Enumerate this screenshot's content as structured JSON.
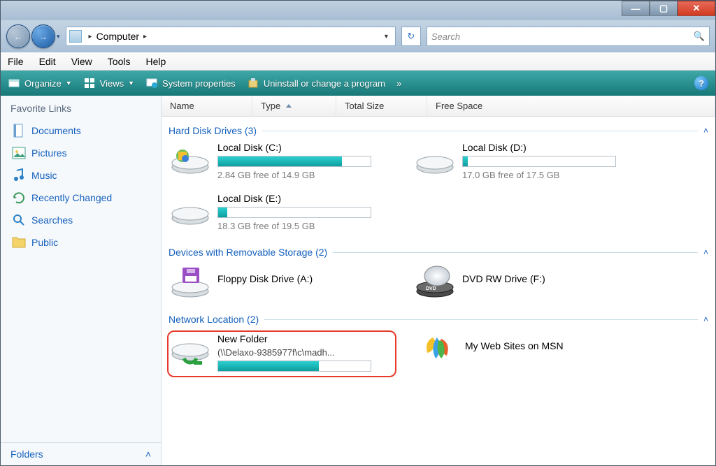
{
  "titlebar": {
    "min": "—",
    "max": "▢",
    "close": "✕"
  },
  "nav": {
    "back_arrow": "←",
    "fwd_arrow": "→",
    "breadcrumb_root": "Computer",
    "search_placeholder": "Search",
    "refresh_glyph": "↻",
    "dropdown_glyph": "▾",
    "mag_glyph": "🔍"
  },
  "menu": {
    "file": "File",
    "edit": "Edit",
    "view": "View",
    "tools": "Tools",
    "help": "Help"
  },
  "toolbar": {
    "organize": "Organize",
    "views": "Views",
    "sysprops": "System properties",
    "uninstall": "Uninstall or change a program",
    "overflow": "»",
    "caret": "▼"
  },
  "sidebar": {
    "header": "Favorite Links",
    "items": [
      {
        "label": "Documents",
        "icon": "doc"
      },
      {
        "label": "Pictures",
        "icon": "pic"
      },
      {
        "label": "Music",
        "icon": "music"
      },
      {
        "label": "Recently Changed",
        "icon": "recent"
      },
      {
        "label": "Searches",
        "icon": "search"
      },
      {
        "label": "Public",
        "icon": "public"
      }
    ],
    "folders_label": "Folders",
    "folders_caret": "˄"
  },
  "columns": {
    "name": "Name",
    "type": "Type",
    "total": "Total Size",
    "free": "Free Space"
  },
  "groups": {
    "hdd": {
      "title": "Hard Disk Drives (3)"
    },
    "removable": {
      "title": "Devices with Removable Storage (2)"
    },
    "network": {
      "title": "Network Location (2)"
    }
  },
  "drives": {
    "c": {
      "name": "Local Disk (C:)",
      "free": "2.84 GB free of 14.9 GB",
      "pct": 81
    },
    "d": {
      "name": "Local Disk (D:)",
      "free": "17.0 GB free of 17.5 GB",
      "pct": 3
    },
    "e": {
      "name": "Local Disk (E:)",
      "free": "18.3 GB free of 19.5 GB",
      "pct": 6
    },
    "floppy": {
      "name": "Floppy Disk Drive (A:)"
    },
    "dvd": {
      "name": "DVD RW Drive (F:)"
    },
    "netfolder": {
      "name": "New Folder",
      "path": "(\\\\Delaxo-9385977f\\c\\madh...",
      "pct": 66
    },
    "msn": {
      "name": "My Web Sites on MSN"
    }
  },
  "collapse_glyph": "˄"
}
